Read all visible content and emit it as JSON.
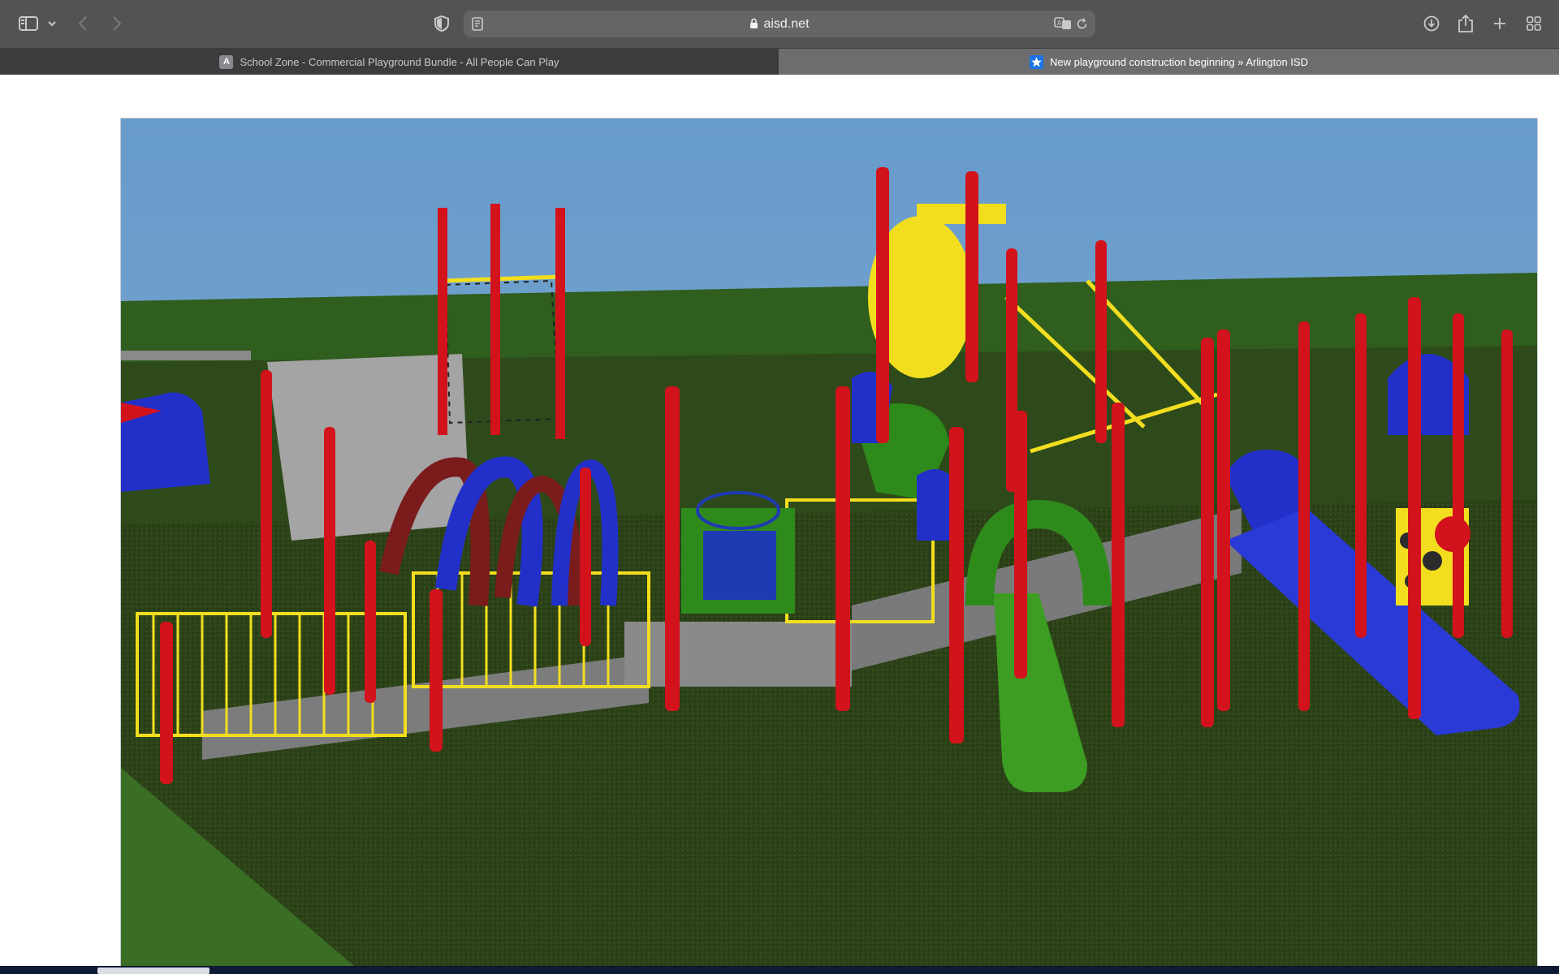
{
  "browser": {
    "address": {
      "host": "aisd.net"
    },
    "tabs": [
      {
        "label": "School Zone - Commercial Playground Bundle - All People Can Play",
        "favicon": "A",
        "active": false
      },
      {
        "label": "New playground construction beginning » Arlington ISD",
        "favicon": "star-icon",
        "active": true
      }
    ],
    "toolbar_icons": [
      "sidebar-icon",
      "chevron-down-icon",
      "back-icon",
      "forward-icon",
      "shield-icon",
      "reader-icon",
      "lock-icon",
      "translate-icon",
      "reload-icon",
      "download-icon",
      "share-icon",
      "plus-icon",
      "tab-overview-icon"
    ]
  },
  "page": {
    "image": {
      "subject": "playground-rendering",
      "colors": {
        "sky": "#6a9ac7",
        "grass": "#2f5e1e",
        "turf": "#2c4218",
        "posts": "#d2131c",
        "rails": "#f2de1f",
        "slide_blue": "#2230c9",
        "slide_green": "#2f8a1c",
        "deck": "#7c7c7c"
      }
    }
  },
  "colors": {
    "toolbar": "#535355",
    "tab_inactive": "#3c3c3e",
    "tab_active": "#6d6d70",
    "accent": "#1a73e8"
  }
}
